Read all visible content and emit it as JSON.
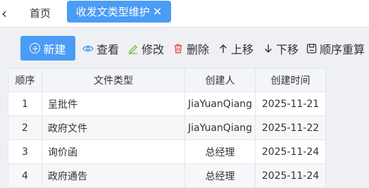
{
  "tabs": {
    "back_symbol": "‹",
    "home_label": "首页",
    "active_label": "收发文类型维护",
    "close_symbol": "✕"
  },
  "toolbar": {
    "new_label": "新建",
    "view_label": "查看",
    "edit_label": "修改",
    "delete_label": "删除",
    "move_up_label": "上移",
    "move_down_label": "下移",
    "reorder_label": "顺序重算"
  },
  "table": {
    "headers": [
      "顺序",
      "文件类型",
      "创建人",
      "创建时间"
    ],
    "rows": [
      [
        "1",
        "呈批件",
        "JiaYuanQiang",
        "2025-11-21"
      ],
      [
        "2",
        "政府文件",
        "JiaYuanQiang",
        "2025-11-22"
      ],
      [
        "3",
        "询价函",
        "总经理",
        "2025-11-24"
      ],
      [
        "4",
        "政府通告",
        "总经理",
        "2025-11-24"
      ]
    ]
  },
  "colors": {
    "accent": "#4a9cf5",
    "delete_icon": "#e05050",
    "edit_icon": "#7cbf3b",
    "view_icon": "#4a9cf5"
  }
}
